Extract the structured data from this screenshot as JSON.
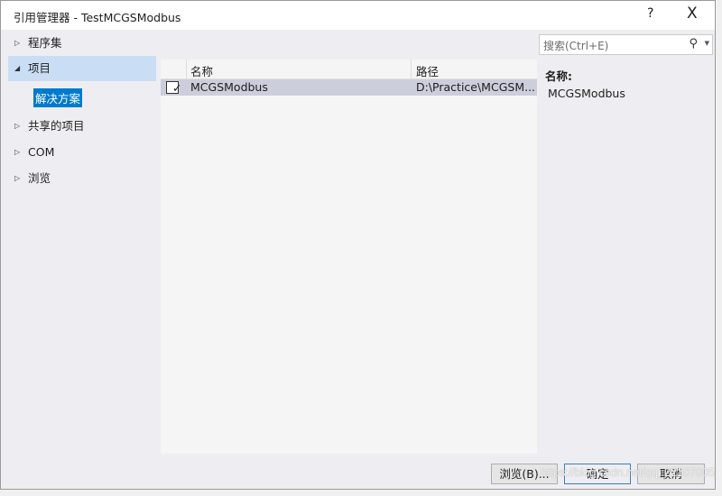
{
  "window": {
    "title": "引用管理器 - TestMCGSModbus",
    "help": "?",
    "close": "X"
  },
  "sidebar": {
    "items": [
      {
        "label": "程序集",
        "expanded": false
      },
      {
        "label": "项目",
        "expanded": true,
        "selected": true
      },
      {
        "label": "共享的项目",
        "expanded": false
      },
      {
        "label": "COM",
        "expanded": false
      },
      {
        "label": "浏览",
        "expanded": false
      }
    ],
    "subitem": "解决方案"
  },
  "table": {
    "columns": [
      "名称",
      "路径"
    ],
    "rows": [
      {
        "checked": true,
        "name": "MCGSModbus",
        "path": "D:\\Practice\\MCGSM..."
      }
    ]
  },
  "search": {
    "placeholder": "搜索(Ctrl+E)",
    "icon": "search-icon"
  },
  "details": {
    "label": "名称:",
    "value": "MCGSModbus"
  },
  "buttons": {
    "browse": "浏览(B)...",
    "ok": "确定",
    "cancel": "取消"
  },
  "watermark": "https://blog.csdn.net/qq_22107005"
}
